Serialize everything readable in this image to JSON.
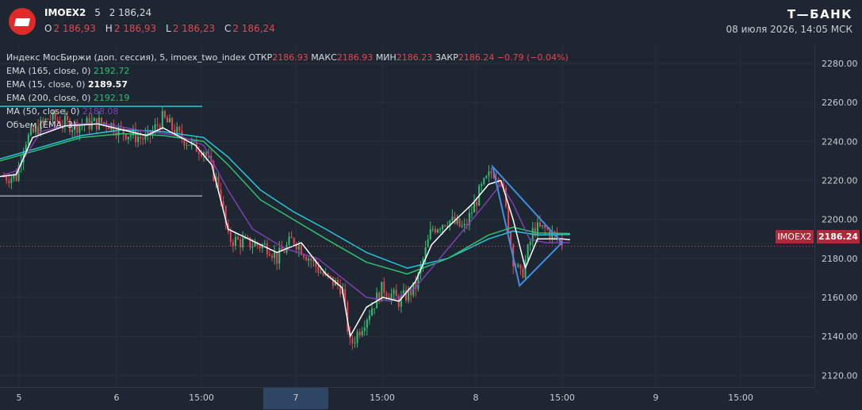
{
  "header": {
    "ticker": "IMOEX2",
    "interval": "5",
    "last_price": "2 186,24",
    "ohlc": [
      {
        "label": "O",
        "value": "2 186,93"
      },
      {
        "label": "H",
        "value": "2 186,93"
      },
      {
        "label": "L",
        "value": "2 186,23"
      },
      {
        "label": "C",
        "value": "2 186,24"
      }
    ],
    "brand": "Т—БАНК",
    "datetime": "08 июля 2026, 14:05 МСК"
  },
  "legend": {
    "main": {
      "prefix": "Индекс МосБиржи (доп. сессия), 5, imoex_two_index",
      "open_label": "ОТКР",
      "open_value": "2186.93",
      "high_label": "МАКС",
      "high_value": "2186.93",
      "low_label": "МИН",
      "low_value": "2186.23",
      "close_label": "ЗАКР",
      "close_value": "2186.24",
      "change": "−0.79 (−0.04%)"
    },
    "indicators": [
      {
        "label": "EMA (165, close, 0)",
        "value": "2192.72",
        "color": "#2fbf71"
      },
      {
        "label": "EMA (15, close, 0)",
        "value": "2189.57",
        "color": "#ffffff"
      },
      {
        "label": "EMA (200, close, 0)",
        "value": "2192.19",
        "color": "#26c6da"
      },
      {
        "label": "MA (50, close, 0)",
        "value": "2188.08",
        "color": "#7d3fb3"
      },
      {
        "label": "Объем (EMA, 3)",
        "value": "",
        "color": "#d6dbe2"
      }
    ]
  },
  "price_badge": {
    "symbol": "IMOEX2",
    "price": "2186.24"
  },
  "colors": {
    "background": "#1e2631",
    "up": "#2fbf71",
    "down": "#e84452",
    "ema15": "#ffffff",
    "ema165": "#2fbf71",
    "ema200": "#26c6da",
    "ma50": "#7d3fb3",
    "triangle": "#3d8ee8",
    "hline_top": "#26c6da",
    "hline_bottom": "#9aa3ad"
  },
  "chart_data": {
    "type": "candlestick",
    "ylim": [
      2110,
      2290
    ],
    "y_ticks": [
      "2120.00",
      "2140.00",
      "2160.00",
      "2180.00",
      "2200.00",
      "2220.00",
      "2240.00",
      "2260.00",
      "2280.00"
    ],
    "x_labels": [
      "5",
      "6",
      "15:00",
      "7",
      "15:00",
      "8",
      "15:00",
      "9",
      "15:00"
    ],
    "x_highlight": "7",
    "price_line": 2186.24,
    "horizontal_lines": [
      {
        "y": 2258,
        "color": "#26c6da"
      },
      {
        "y": 2212,
        "color": "#9aa3ad"
      }
    ],
    "close_path": [
      [
        0,
        2222
      ],
      [
        0.02,
        2222
      ],
      [
        0.03,
        2240
      ],
      [
        0.06,
        2252
      ],
      [
        0.09,
        2248
      ],
      [
        0.13,
        2250
      ],
      [
        0.15,
        2245
      ],
      [
        0.18,
        2241
      ],
      [
        0.2,
        2252
      ],
      [
        0.22,
        2243
      ],
      [
        0.24,
        2237
      ],
      [
        0.25,
        2236
      ],
      [
        0.27,
        2215
      ],
      [
        0.28,
        2190
      ],
      [
        0.3,
        2188
      ],
      [
        0.33,
        2186
      ],
      [
        0.34,
        2180
      ],
      [
        0.36,
        2190
      ],
      [
        0.38,
        2180
      ],
      [
        0.4,
        2170
      ],
      [
        0.42,
        2165
      ],
      [
        0.43,
        2135
      ],
      [
        0.45,
        2150
      ],
      [
        0.47,
        2165
      ],
      [
        0.49,
        2158
      ],
      [
        0.51,
        2165
      ],
      [
        0.53,
        2195
      ],
      [
        0.55,
        2200
      ],
      [
        0.57,
        2195
      ],
      [
        0.59,
        2215
      ],
      [
        0.605,
        2225
      ],
      [
        0.615,
        2222
      ],
      [
        0.63,
        2180
      ],
      [
        0.64,
        2170
      ],
      [
        0.655,
        2195
      ],
      [
        0.67,
        2195
      ],
      [
        0.69,
        2188
      ],
      [
        0.7,
        2186
      ]
    ],
    "ema15_path": [
      [
        0,
        2222
      ],
      [
        0.02,
        2223
      ],
      [
        0.04,
        2242
      ],
      [
        0.08,
        2248
      ],
      [
        0.12,
        2249
      ],
      [
        0.15,
        2246
      ],
      [
        0.18,
        2243
      ],
      [
        0.2,
        2247
      ],
      [
        0.24,
        2238
      ],
      [
        0.26,
        2228
      ],
      [
        0.28,
        2195
      ],
      [
        0.31,
        2189
      ],
      [
        0.34,
        2183
      ],
      [
        0.37,
        2188
      ],
      [
        0.4,
        2172
      ],
      [
        0.42,
        2165
      ],
      [
        0.43,
        2140
      ],
      [
        0.45,
        2155
      ],
      [
        0.47,
        2160
      ],
      [
        0.49,
        2158
      ],
      [
        0.51,
        2168
      ],
      [
        0.53,
        2187
      ],
      [
        0.55,
        2196
      ],
      [
        0.58,
        2208
      ],
      [
        0.6,
        2218
      ],
      [
        0.615,
        2220
      ],
      [
        0.63,
        2200
      ],
      [
        0.645,
        2175
      ],
      [
        0.66,
        2190
      ],
      [
        0.69,
        2190
      ],
      [
        0.7,
        2189.57
      ]
    ],
    "ema165_path": [
      [
        0,
        2230
      ],
      [
        0.05,
        2236
      ],
      [
        0.1,
        2242
      ],
      [
        0.15,
        2244
      ],
      [
        0.2,
        2243
      ],
      [
        0.25,
        2240
      ],
      [
        0.28,
        2228
      ],
      [
        0.32,
        2210
      ],
      [
        0.36,
        2200
      ],
      [
        0.4,
        2190
      ],
      [
        0.45,
        2178
      ],
      [
        0.5,
        2172
      ],
      [
        0.55,
        2180
      ],
      [
        0.6,
        2192
      ],
      [
        0.63,
        2196
      ],
      [
        0.66,
        2193
      ],
      [
        0.7,
        2192.72
      ]
    ],
    "ema200_path": [
      [
        0,
        2231
      ],
      [
        0.05,
        2237
      ],
      [
        0.1,
        2243
      ],
      [
        0.15,
        2246
      ],
      [
        0.2,
        2245
      ],
      [
        0.25,
        2242
      ],
      [
        0.28,
        2232
      ],
      [
        0.32,
        2215
      ],
      [
        0.36,
        2204
      ],
      [
        0.4,
        2195
      ],
      [
        0.45,
        2183
      ],
      [
        0.5,
        2175
      ],
      [
        0.55,
        2180
      ],
      [
        0.6,
        2190
      ],
      [
        0.63,
        2194
      ],
      [
        0.66,
        2192
      ],
      [
        0.7,
        2192.19
      ]
    ],
    "ma50_path": [
      [
        0,
        2222
      ],
      [
        0.02,
        2225
      ],
      [
        0.05,
        2245
      ],
      [
        0.09,
        2249
      ],
      [
        0.13,
        2249
      ],
      [
        0.18,
        2245
      ],
      [
        0.22,
        2243
      ],
      [
        0.25,
        2238
      ],
      [
        0.28,
        2215
      ],
      [
        0.31,
        2195
      ],
      [
        0.35,
        2185
      ],
      [
        0.39,
        2180
      ],
      [
        0.42,
        2170
      ],
      [
        0.45,
        2160
      ],
      [
        0.48,
        2158
      ],
      [
        0.51,
        2165
      ],
      [
        0.55,
        2185
      ],
      [
        0.59,
        2205
      ],
      [
        0.615,
        2218
      ],
      [
        0.63,
        2208
      ],
      [
        0.65,
        2190
      ],
      [
        0.67,
        2188
      ],
      [
        0.7,
        2188.08
      ]
    ],
    "triangle": [
      [
        0.605,
        2227
      ],
      [
        0.69,
        2188
      ],
      [
        0.638,
        2166
      ]
    ]
  }
}
